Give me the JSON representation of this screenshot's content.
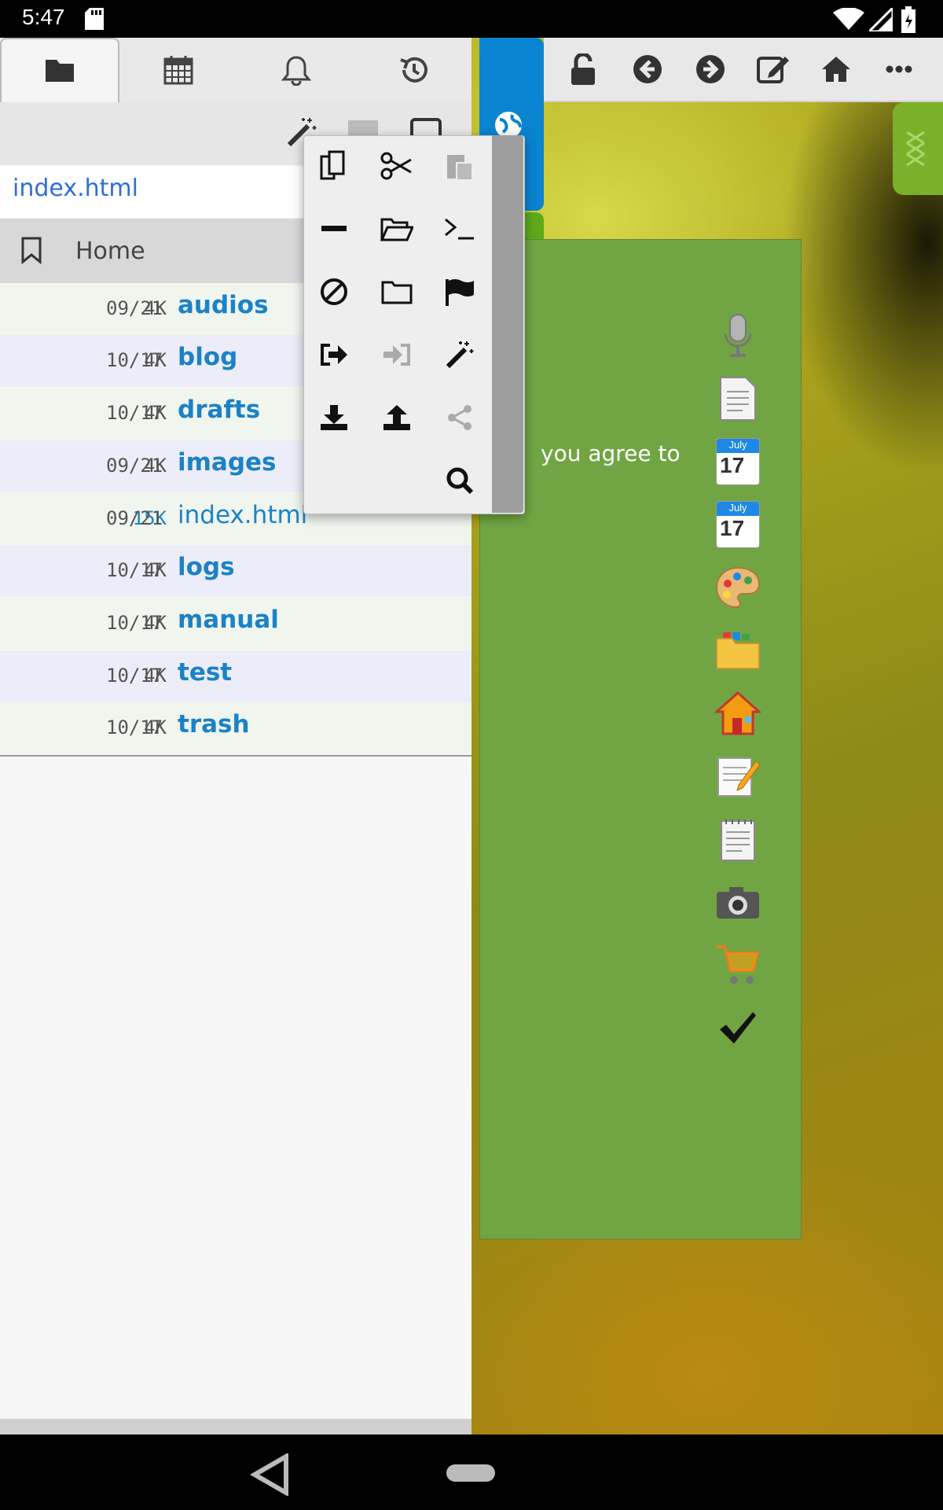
{
  "status_bar": {
    "time": "5:47"
  },
  "path": {
    "value": "index.html"
  },
  "home": {
    "label": "Home"
  },
  "files": [
    {
      "size": "4K",
      "date": "09/21",
      "name": "audios"
    },
    {
      "size": "4K",
      "date": "10/17",
      "name": "blog"
    },
    {
      "size": "4K",
      "date": "10/17",
      "name": "drafts"
    },
    {
      "size": "4K",
      "date": "09/21",
      "name": "images"
    },
    {
      "size": "15K",
      "date": "09/21",
      "name": "index.html"
    },
    {
      "size": "4K",
      "date": "10/17",
      "name": "logs"
    },
    {
      "size": "4K",
      "date": "10/17",
      "name": "manual"
    },
    {
      "size": "4K",
      "date": "10/17",
      "name": "test"
    },
    {
      "size": "4K",
      "date": "10/17",
      "name": "trash"
    }
  ],
  "content": {
    "agree_text": "you agree to"
  },
  "calendar": {
    "month": "July",
    "day": "17"
  },
  "colors": {
    "link": "#1b82c6",
    "tab_blue": "#0a84d0",
    "tab_green": "#5fa91a",
    "tab_orange": "#ef7d12",
    "page_green": "#71a543"
  }
}
